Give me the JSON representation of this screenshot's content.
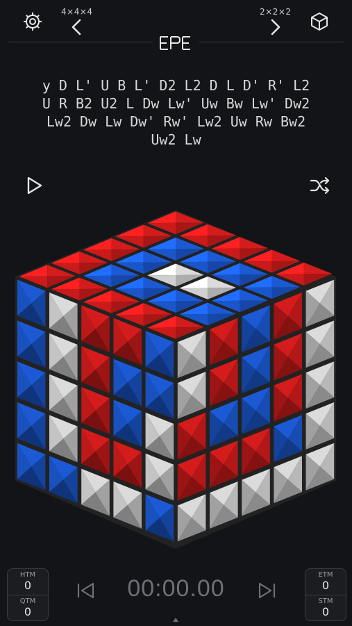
{
  "header": {
    "left_size_label": "4×4×4",
    "right_size_label": "2×2×2",
    "logo_text": "EPE"
  },
  "scramble": {
    "lines": [
      "y D L' U B L' D2 L2 D L D' R' L2",
      "U R B2 U2 L Dw Lw' Uw Bw Lw' Dw2",
      "Lw2 Dw Lw Dw' Rw' Lw2 Uw Rw Bw2",
      "Uw2 Lw"
    ]
  },
  "cube": {
    "colors": {
      "red": "#e01d1d",
      "blue": "#1d5fe0",
      "white": "#e6e6e6"
    },
    "top": [
      [
        "red",
        "red",
        "red",
        "red",
        "red"
      ],
      [
        "red",
        "blue",
        "blue",
        "blue",
        "red"
      ],
      [
        "red",
        "blue",
        "white",
        "blue",
        "red"
      ],
      [
        "red",
        "blue",
        "white",
        "blue",
        "red"
      ],
      [
        "red",
        "blue",
        "blue",
        "blue",
        "red"
      ]
    ],
    "left": [
      [
        "blue",
        "white",
        "red",
        "red",
        "blue"
      ],
      [
        "blue",
        "white",
        "red",
        "blue",
        "blue"
      ],
      [
        "blue",
        "white",
        "red",
        "blue",
        "white"
      ],
      [
        "blue",
        "white",
        "red",
        "red",
        "white"
      ],
      [
        "blue",
        "blue",
        "white",
        "white",
        "blue"
      ]
    ],
    "right": [
      [
        "white",
        "red",
        "blue",
        "red",
        "white"
      ],
      [
        "white",
        "red",
        "blue",
        "red",
        "white"
      ],
      [
        "red",
        "blue",
        "blue",
        "red",
        "white"
      ],
      [
        "red",
        "red",
        "red",
        "blue",
        "white"
      ],
      [
        "white",
        "white",
        "white",
        "white",
        "white"
      ]
    ]
  },
  "stats": {
    "htm_label": "HTM",
    "htm_value": "0",
    "qtm_label": "QTM",
    "qtm_value": "0",
    "etm_label": "ETM",
    "etm_value": "0",
    "stm_label": "STM",
    "stm_value": "0"
  },
  "timer": {
    "value": "00:00.00"
  },
  "accent": "#e6e6e6",
  "muted": "#6e7078"
}
